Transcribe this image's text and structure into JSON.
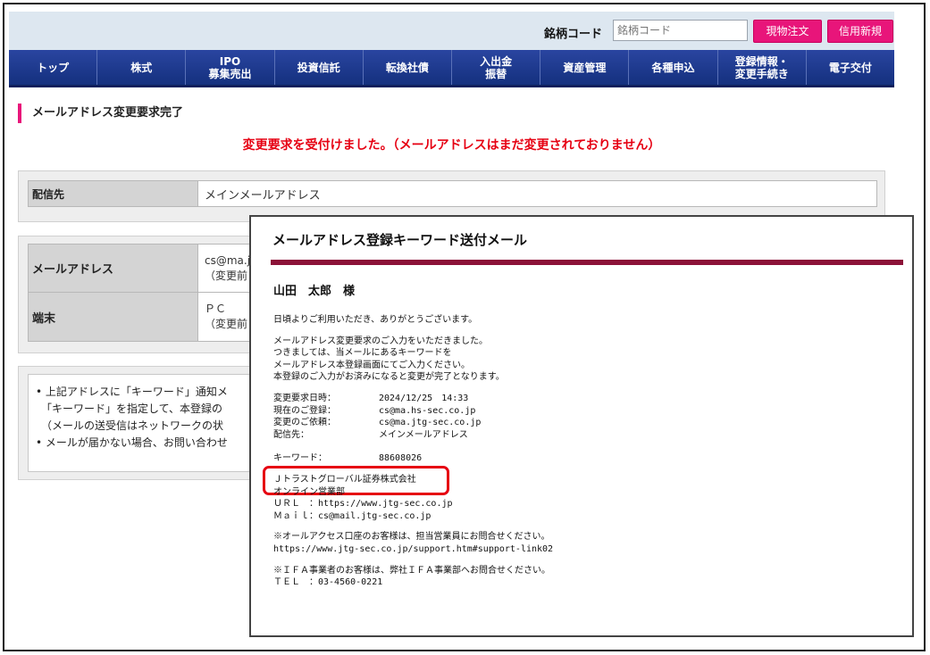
{
  "header": {
    "code_label": "銘柄コード",
    "code_placeholder": "銘柄コード",
    "btn_genbutsu": "現物注文",
    "btn_shinyo": "信用新規"
  },
  "nav": [
    "トップ",
    "株式",
    "IPO\n募集売出",
    "投資信託",
    "転換社債",
    "入出金\n振替",
    "資産管理",
    "各種申込",
    "登録情報・\n変更手続き",
    "電子交付"
  ],
  "page": {
    "title": "メールアドレス変更要求完了",
    "message": "変更要求を受付けました。（メールアドレスはまだ変更されておりません）"
  },
  "delivery": {
    "label": "配信先",
    "value": "メインメールアドレス"
  },
  "details": [
    {
      "label": "メールアドレス",
      "line1": "cs@ma.j",
      "line2": "（変更前"
    },
    {
      "label": "端末",
      "line1": "ＰＣ",
      "line2": "（変更前"
    }
  ],
  "notes": [
    "• 上記アドレスに「キーワード」通知メ",
    "　「キーワード」を指定して、本登録の",
    "　（メールの送受信はネットワークの状",
    "• メールが届かない場合、お問い合わせ"
  ],
  "mail": {
    "title": "メールアドレス登録キーワード送付メール",
    "addressee": "山田　太郎　様",
    "greeting": "日頃よりご利用いただき、ありがとうございます。",
    "intro": [
      "メールアドレス変更要求のご入力をいただきました。",
      "つきましては、当メールにあるキーワードを",
      "メールアドレス本登録画面にてご入力ください。",
      "本登録のご入力がお済みになると変更が完了となります。"
    ],
    "fields": [
      {
        "k": "変更要求日時：",
        "v": "2024/12/25　14:33"
      },
      {
        "k": "現在のご登録：",
        "v": "cs@ma.hs-sec.co.jp"
      },
      {
        "k": "変更のご依頼：",
        "v": "cs@ma.jtg-sec.co.jp"
      },
      {
        "k": "配信先：",
        "v": "メインメールアドレス"
      }
    ],
    "keyword_label": "キーワード：",
    "keyword_value": "88608026",
    "company": [
      "Ｊトラストグローバル証券株式会社",
      "オンライン営業部",
      "ＵＲＬ　：https://www.jtg-sec.co.jp",
      "Ｍａｉｌ：cs@mail.jtg-sec.co.jp"
    ],
    "all_access": "※オールアクセス口座のお客様は、担当営業員にお問合せください。",
    "support_url": "https://www.jtg-sec.co.jp/support.htm#support-link02",
    "ifa": "※ＩＦＡ事業者のお客様は、弊社ＩＦＡ事業部へお問合せください。",
    "tel": "ＴＥＬ　：03-4560-0221"
  }
}
